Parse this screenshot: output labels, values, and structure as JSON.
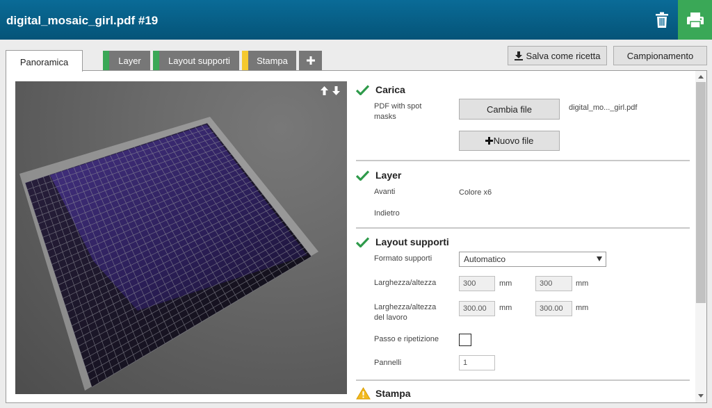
{
  "header": {
    "title": "digital_mosaic_girl.pdf #19"
  },
  "icons": {
    "trash": "trash-icon",
    "print": "printer-icon",
    "move_up": "arrow-up-icon",
    "move_down": "arrow-down-icon",
    "check": "check-icon",
    "warning": "warning-icon",
    "plus": "plus-icon"
  },
  "colors": {
    "header": "#055a80",
    "print_button": "#3aa857",
    "check": "#2e9a4a",
    "stripe_green": "#3aa857",
    "stripe_yellow": "#f5c92e",
    "warning": "#f2b91d"
  },
  "tabs": [
    {
      "label": "Panoramica",
      "active": true
    },
    {
      "label": "Layer",
      "stripe": "#3aa857"
    },
    {
      "label": "Layout supporti",
      "stripe": "#3aa857"
    },
    {
      "label": "Stampa",
      "stripe": "#f5c92e"
    },
    {
      "label": "+"
    }
  ],
  "toolbar": {
    "save_recipe": "Salva come ricetta",
    "sampling": "Campionamento"
  },
  "sections": {
    "carica": {
      "title": "Carica",
      "label": "PDF with spot masks",
      "change_file": "Cambia file",
      "file_name": "digital_mo..._girl.pdf",
      "new_file": "Nuovo file"
    },
    "layer": {
      "title": "Layer",
      "front_label": "Avanti",
      "front_value": "Colore x6",
      "back_label": "Indietro"
    },
    "layout": {
      "title": "Layout supporti",
      "format_label": "Formato supporti",
      "format_value": "Automatico",
      "size_label": "Larghezza/altezza",
      "width": "300",
      "height": "300",
      "unit": "mm",
      "job_size_label": "Larghezza/altezza del lavoro",
      "job_width": "300.00",
      "job_height": "300.00",
      "step_label": "Passo e ripetizione",
      "panels_label": "Pannelli",
      "panels_value": "1"
    },
    "stampa": {
      "title": "Stampa"
    }
  }
}
